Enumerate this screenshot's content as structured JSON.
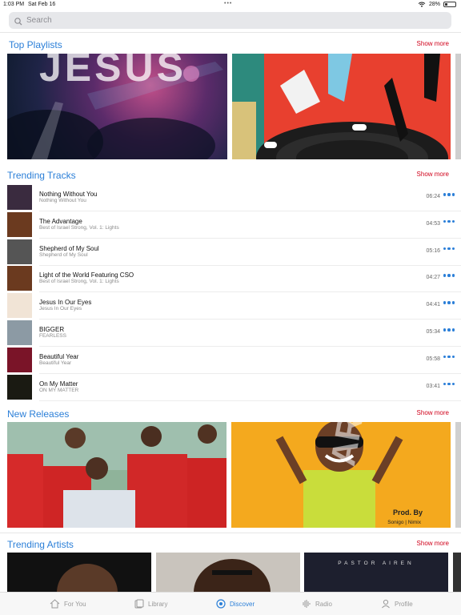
{
  "status": {
    "time": "1:03 PM",
    "date": "Sat Feb 16",
    "battery": "28%",
    "battery_level": 0.28
  },
  "search": {
    "placeholder": "Search"
  },
  "sections": {
    "top_playlists": {
      "title": "Top Playlists",
      "show_more": "Show more"
    },
    "trending_tracks": {
      "title": "Trending Tracks",
      "show_more": "Show more"
    },
    "new_releases": {
      "title": "New Releases",
      "show_more": "Show more"
    },
    "trending_artists": {
      "title": "Trending Artists",
      "show_more": "Show more"
    }
  },
  "playlist_tiles": [
    {
      "overlay_text": "JESUS"
    },
    {
      "overlay_text": ""
    }
  ],
  "release_tiles": [
    {
      "overlay_text": ""
    },
    {
      "overlay_text": "AROUND",
      "credit_line1": "Prod. By",
      "credit_line2": "Sonigo | Nimix"
    }
  ],
  "artist_tiles": [
    {
      "overlay_text": ""
    },
    {
      "overlay_text": ""
    },
    {
      "overlay_text": "PASTOR AIREN"
    }
  ],
  "tracks": [
    {
      "title": "Nothing Without You",
      "subtitle": "Nothing Without You",
      "duration": "06:24",
      "color": "#3a2b3f"
    },
    {
      "title": "The Advantage",
      "subtitle": "Best of Israel Strong, Vol. 1: Lights",
      "duration": "04:53",
      "color": "#6b3a1f"
    },
    {
      "title": "Shepherd of My Soul",
      "subtitle": "Shepherd of My Soul",
      "duration": "05:16",
      "color": "#555555"
    },
    {
      "title": "Light of the World Featuring CSO",
      "subtitle": "Best of Israel Strong, Vol. 1: Lights",
      "duration": "04:27",
      "color": "#6b3a1f"
    },
    {
      "title": "Jesus In Our Eyes",
      "subtitle": "Jesus In Our Eyes",
      "duration": "04:41",
      "color": "#f1e4d6"
    },
    {
      "title": "BIGGER",
      "subtitle": "FEARLESS",
      "duration": "05:34",
      "color": "#8c9aa4"
    },
    {
      "title": "Beautiful Year",
      "subtitle": "Beautiful Year",
      "duration": "05:58",
      "color": "#7a1428"
    },
    {
      "title": "On My Matter",
      "subtitle": "ON MY MATTER",
      "duration": "03:41",
      "color": "#1a1a12"
    }
  ],
  "tabs": [
    {
      "label": "For You",
      "icon": "home-icon",
      "active": false
    },
    {
      "label": "Library",
      "icon": "library-icon",
      "active": false
    },
    {
      "label": "Discover",
      "icon": "discover-icon",
      "active": true
    },
    {
      "label": "Radio",
      "icon": "radio-icon",
      "active": false
    },
    {
      "label": "Profile",
      "icon": "profile-icon",
      "active": false
    }
  ],
  "colors": {
    "accent": "#2b7fd8",
    "show_more": "#d0021b"
  }
}
